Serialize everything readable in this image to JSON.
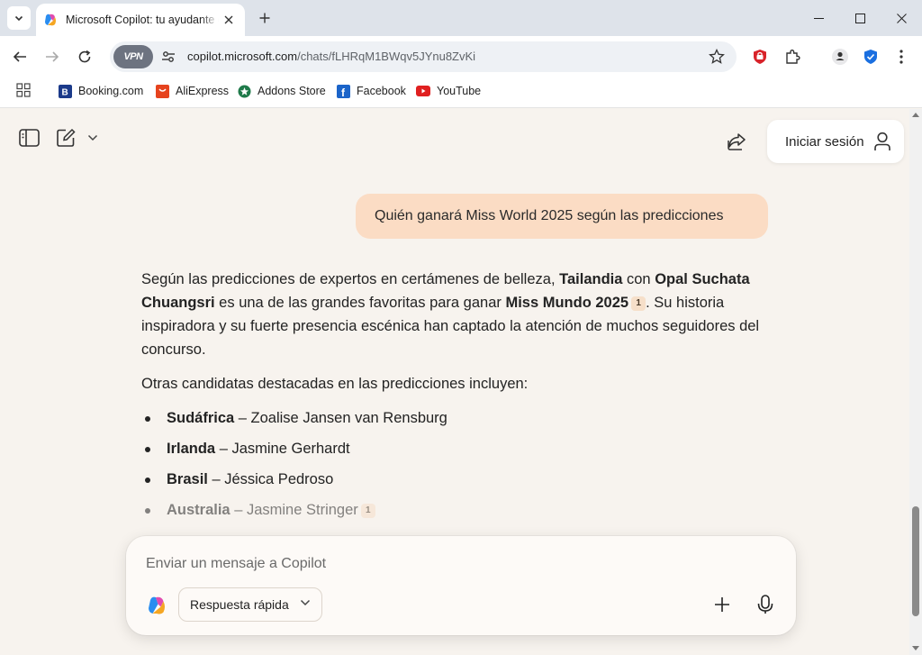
{
  "browser": {
    "tab_title": "Microsoft Copilot: tu ayudante de IA",
    "url_host": "copilot.microsoft.com",
    "url_path": "/chats/fLHRqM1BWqv5JYnu8ZvKi",
    "vpn_label": "VPN",
    "bookmarks": [
      {
        "label": "Booking.com",
        "icon": "booking-icon",
        "color": "#1b3a8a"
      },
      {
        "label": "AliExpress",
        "icon": "aliexpress-icon",
        "color": "#e6431e"
      },
      {
        "label": "Addons Store",
        "icon": "addons-store-icon",
        "color": "#1f7a4a"
      },
      {
        "label": "Facebook",
        "icon": "facebook-icon",
        "color": "#1b64c9"
      },
      {
        "label": "YouTube",
        "icon": "youtube-icon",
        "color": "#e02020"
      }
    ]
  },
  "header": {
    "signin_label": "Iniciar sesión"
  },
  "chat": {
    "user_message": "Quién ganará Miss World 2025 según las predicciones",
    "answer": {
      "p1": {
        "t1": "Según las predicciones de expertos en certámenes de belleza, ",
        "b1": "Tailandia",
        "t2": " con ",
        "b2": "Opal Suchata Chuangsri",
        "t3": " es una de las grandes favoritas para ganar ",
        "b3": "Miss Mundo 2025",
        "cite": "1",
        "t4": ". Su historia inspiradora y su fuerte presencia escénica han captado la atención de muchos seguidores del concurso."
      },
      "p2": "Otras candidatas destacadas en las predicciones incluyen:",
      "candidates": [
        {
          "country": "Sudáfrica",
          "name": " – Zoalise Jansen van Rensburg"
        },
        {
          "country": "Irlanda",
          "name": " – Jasmine Gerhardt"
        },
        {
          "country": "Brasil",
          "name": " – Jéssica Pedroso"
        },
        {
          "country": "Australia",
          "name": " – Jasmine Stringer",
          "cite": "1"
        }
      ]
    }
  },
  "composer": {
    "placeholder": "Enviar un mensaje a Copilot",
    "mode_label": "Respuesta rápida"
  },
  "colors": {
    "page_bg": "#f7f3ee",
    "user_bubble": "#fbdcc4",
    "cite_bg": "#f6dfc9"
  }
}
